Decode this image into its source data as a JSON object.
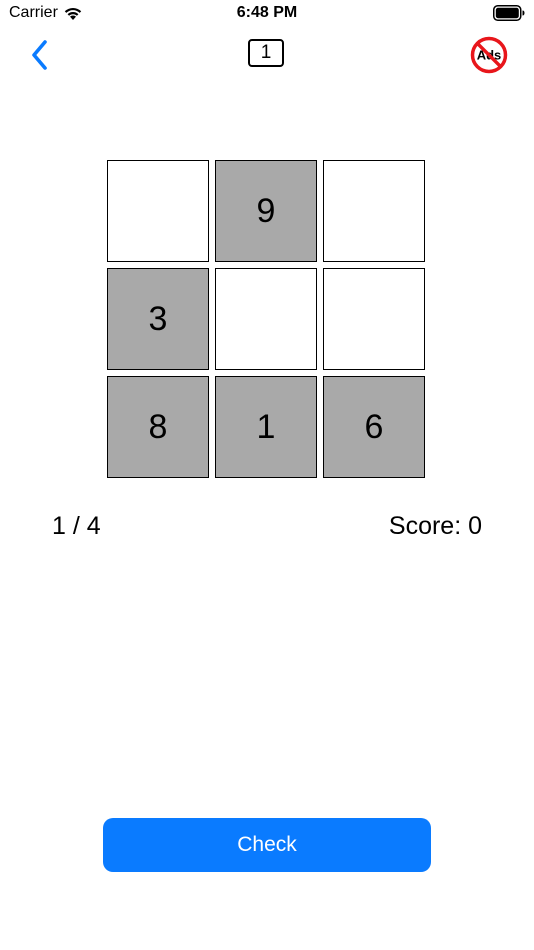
{
  "status_bar": {
    "carrier": "Carrier",
    "time": "6:48 PM",
    "icons": [
      "wifi-icon",
      "battery-icon"
    ]
  },
  "nav": {
    "back_icon": "chevron-left-icon",
    "level": "1",
    "no_ads_icon": "no-ads-icon",
    "no_ads_text": "Ads",
    "accent_color": "#0a7bff",
    "no_ads_color": "#e8161b"
  },
  "grid": {
    "rows": [
      [
        {
          "value": "",
          "filled": false
        },
        {
          "value": "9",
          "filled": true
        },
        {
          "value": "",
          "filled": false
        }
      ],
      [
        {
          "value": "3",
          "filled": true
        },
        {
          "value": "",
          "filled": false
        },
        {
          "value": "",
          "filled": false
        }
      ],
      [
        {
          "value": "8",
          "filled": true
        },
        {
          "value": "1",
          "filled": true
        },
        {
          "value": "6",
          "filled": true
        }
      ]
    ],
    "filled_color": "#a9a9a9",
    "empty_color": "#ffffff"
  },
  "info": {
    "progress": "1 / 4",
    "score": "Score: 0"
  },
  "actions": {
    "check_label": "Check",
    "check_color": "#0a7bff"
  }
}
